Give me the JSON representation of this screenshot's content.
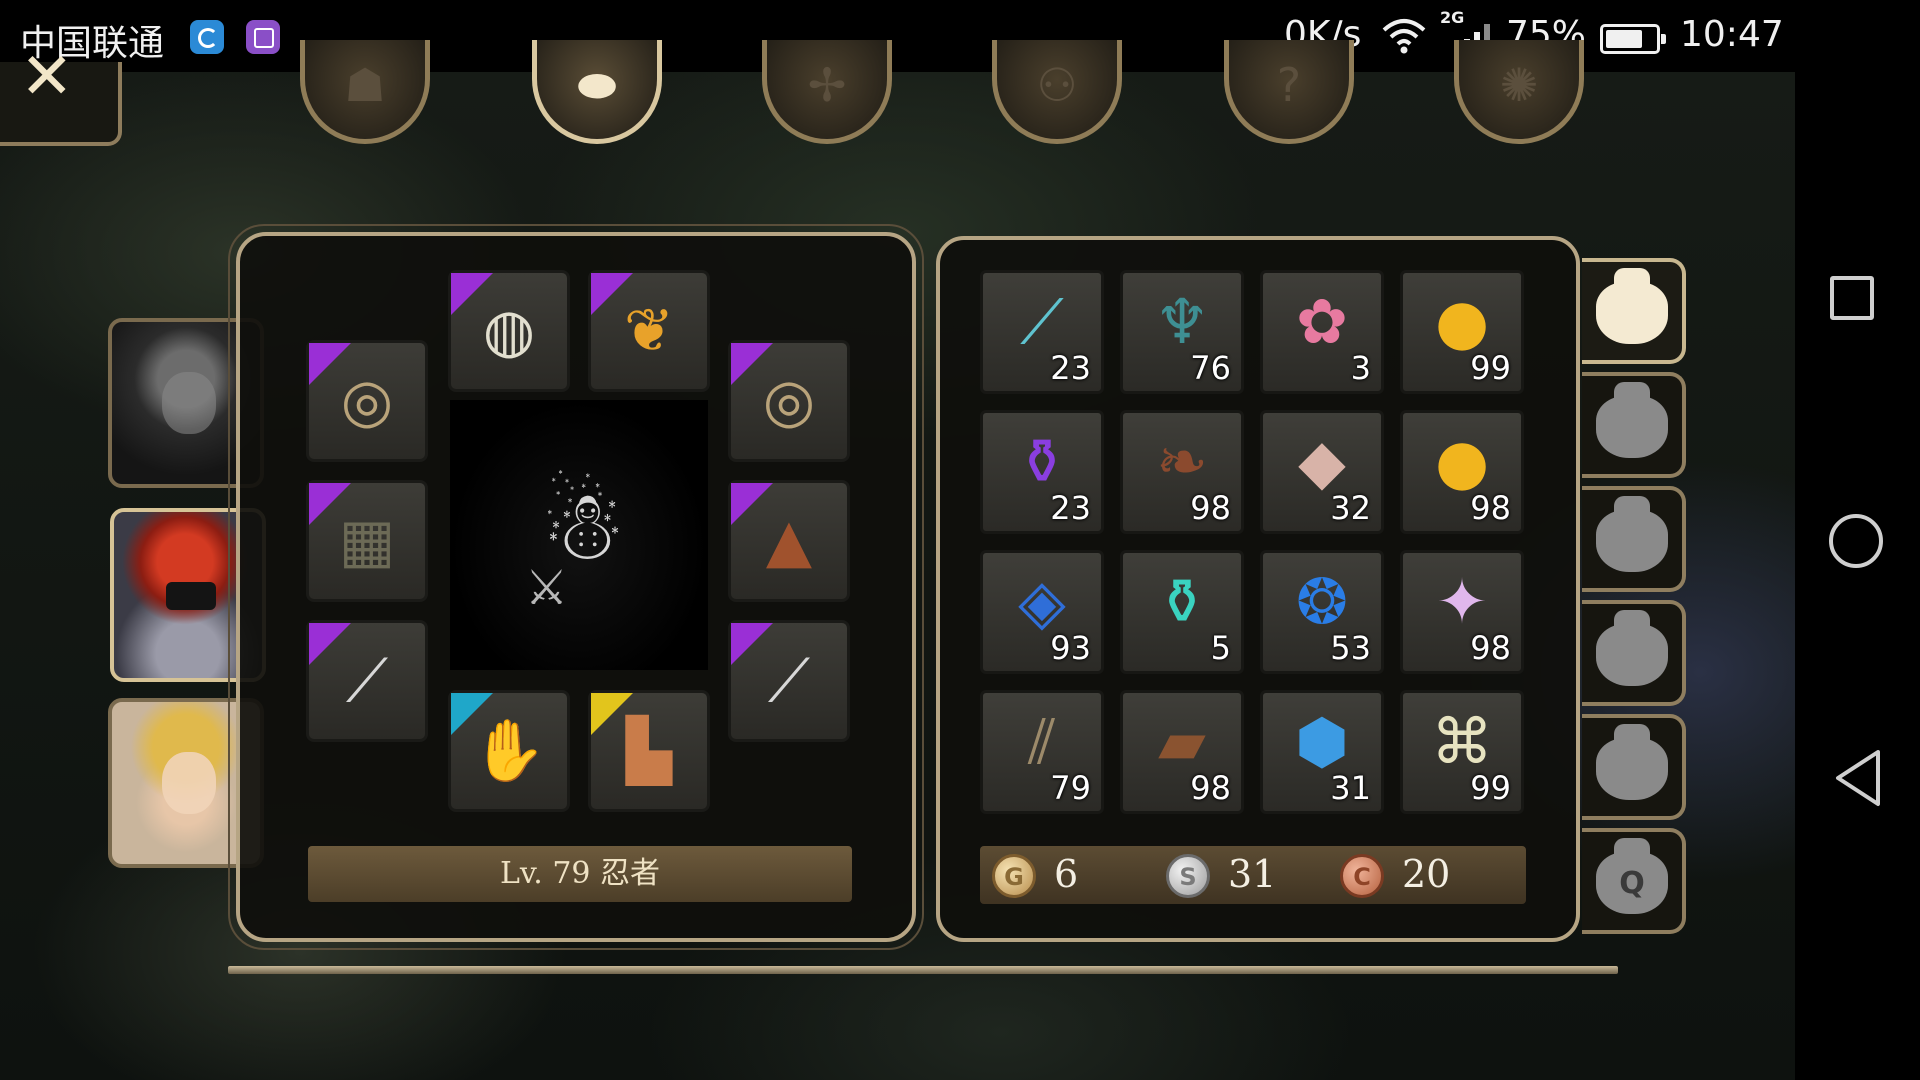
{
  "status_bar": {
    "carrier": "中国联通",
    "net_speed": "0K/s",
    "network_type": "2G",
    "battery_percent": "75%",
    "battery_level": 0.75,
    "time": "10:47"
  },
  "top_tabs": [
    {
      "name": "character-tab-icon",
      "glyph": "☗"
    },
    {
      "name": "bag-tab-icon",
      "glyph": "⬬"
    },
    {
      "name": "skills-tab-icon",
      "glyph": "✢"
    },
    {
      "name": "party-tab-icon",
      "glyph": "⚇"
    },
    {
      "name": "quest-tab-icon",
      "glyph": "?"
    },
    {
      "name": "settings-tab-icon",
      "glyph": "✺"
    }
  ],
  "close_glyph": "✕",
  "party": [
    {
      "name": "portrait-white-hair",
      "active": false
    },
    {
      "name": "portrait-red-hair-ninja",
      "active": true
    },
    {
      "name": "portrait-blonde-girl",
      "active": false
    }
  ],
  "equipment": {
    "level_label": "Lv. 79 忍者",
    "slots": [
      {
        "id": "helmet",
        "glyph": "◍",
        "color": "#e2dfcf",
        "rarity": "#9a2fd6"
      },
      {
        "id": "necklace",
        "glyph": "❦",
        "color": "#e8a22a",
        "rarity": "#9a2fd6"
      },
      {
        "id": "ring-left",
        "glyph": "◎",
        "color": "#b9a37a",
        "rarity": "#9a2fd6"
      },
      {
        "id": "ring-right",
        "glyph": "◎",
        "color": "#b9a37a",
        "rarity": "#9a2fd6"
      },
      {
        "id": "armor",
        "glyph": "▦",
        "color": "#6c6a56",
        "rarity": "#9a2fd6"
      },
      {
        "id": "cloak",
        "glyph": "▲",
        "color": "#a0522d",
        "rarity": "#9a2fd6"
      },
      {
        "id": "weapon-left",
        "glyph": "⟋",
        "color": "#d7d7d7",
        "rarity": "#9a2fd6"
      },
      {
        "id": "weapon-right",
        "glyph": "⟋",
        "color": "#d7d7d7",
        "rarity": "#9a2fd6"
      },
      {
        "id": "gloves",
        "glyph": "✋",
        "color": "#e0a83a",
        "rarity": "#1fa7c9"
      },
      {
        "id": "boots",
        "glyph": "▙",
        "color": "#c97c4a",
        "rarity": "#e2c51c"
      }
    ]
  },
  "inventory": {
    "items": [
      {
        "id": "cyan-branch",
        "glyph": "⟋",
        "color": "#5fc3cf",
        "qty": "23"
      },
      {
        "id": "cyan-root",
        "glyph": "♆",
        "color": "#3e8f93",
        "qty": "76"
      },
      {
        "id": "flower-plant",
        "glyph": "✿",
        "color": "#e77aa0",
        "qty": "3"
      },
      {
        "id": "golden-apple-1",
        "glyph": "●",
        "color": "#f1b51e",
        "qty": "99"
      },
      {
        "id": "purple-potion",
        "glyph": "⚱",
        "color": "#8a3ee0",
        "qty": "23"
      },
      {
        "id": "brown-feather",
        "glyph": "❧",
        "color": "#8b4a2e",
        "qty": "98"
      },
      {
        "id": "pink-powder",
        "glyph": "◆",
        "color": "#d8b3a8",
        "qty": "32"
      },
      {
        "id": "golden-apple-2",
        "glyph": "●",
        "color": "#f1b51e",
        "qty": "98"
      },
      {
        "id": "blue-ore",
        "glyph": "◈",
        "color": "#2f6ed8",
        "qty": "93"
      },
      {
        "id": "teal-vase",
        "glyph": "⚱",
        "color": "#3ad3c0",
        "qty": "5"
      },
      {
        "id": "blue-crystal",
        "glyph": "❂",
        "color": "#2a7de6",
        "qty": "53"
      },
      {
        "id": "pink-shard",
        "glyph": "✦",
        "color": "#e0b7ec",
        "qty": "98"
      },
      {
        "id": "claws",
        "glyph": "⫽",
        "color": "#9c8a6a",
        "qty": "79"
      },
      {
        "id": "leather",
        "glyph": "▰",
        "color": "#8a5330",
        "qty": "98"
      },
      {
        "id": "blue-gems",
        "glyph": "⬢",
        "color": "#3c9be3",
        "qty": "31"
      },
      {
        "id": "scroll",
        "glyph": "⌘",
        "color": "#e7e3c0",
        "qty": "99"
      }
    ],
    "currency": {
      "gold_symbol": "G",
      "gold": "6",
      "silver_symbol": "S",
      "silver": "31",
      "copper_symbol": "C",
      "copper": "20"
    }
  },
  "bag_tabs": [
    {
      "name": "bag-tab-1",
      "active": true,
      "label": ""
    },
    {
      "name": "bag-tab-2",
      "active": false,
      "label": ""
    },
    {
      "name": "bag-tab-3",
      "active": false,
      "label": ""
    },
    {
      "name": "bag-tab-4",
      "active": false,
      "label": ""
    },
    {
      "name": "bag-tab-5",
      "active": false,
      "label": ""
    },
    {
      "name": "bag-tab-quest",
      "active": false,
      "label": "Q"
    }
  ]
}
